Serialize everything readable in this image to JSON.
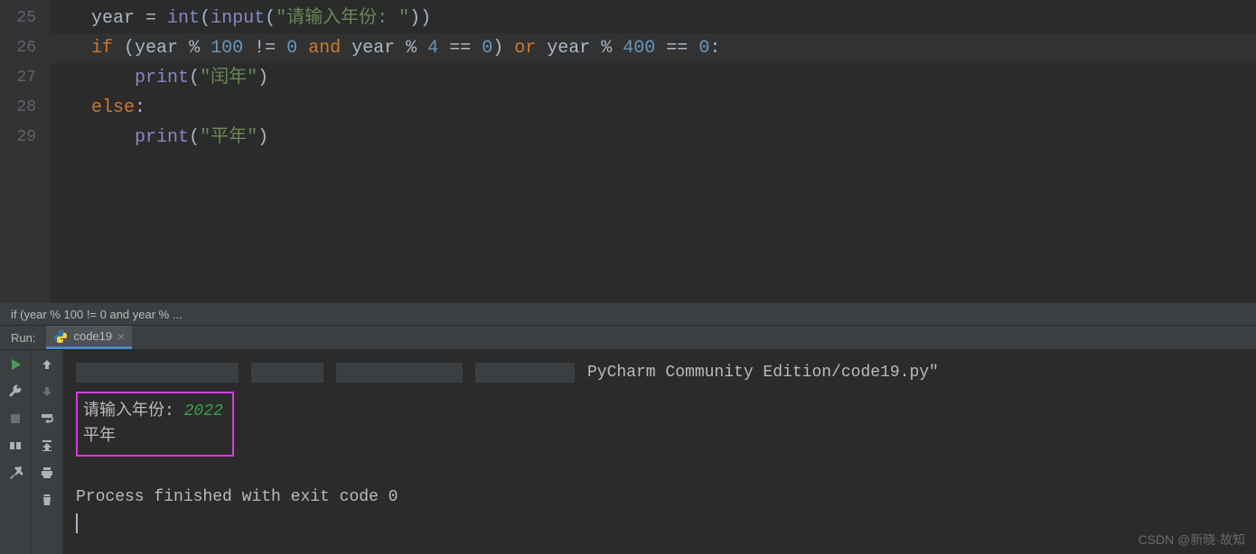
{
  "editor": {
    "lines": [
      25,
      26,
      27,
      28,
      29
    ],
    "highlighted_line": 26,
    "code": {
      "l25": {
        "var": "year",
        "eq": " = ",
        "int": "int",
        "p1": "(",
        "input": "input",
        "p2": "(",
        "str": "\"请输入年份: \"",
        "p3": "))"
      },
      "l26": {
        "if": "if",
        "sp1": " (",
        "var1": "year",
        "sp2": " % ",
        "n100": "100",
        "sp3": " != ",
        "z1": "0",
        "and": " and ",
        "var2": "year",
        "sp4": " % ",
        "n4": "4",
        "sp5": " == ",
        "z2": "0",
        "p2": ")",
        "or": " or ",
        "var3": "year",
        "sp6": " % ",
        "n400": "400",
        "sp7": " == ",
        "z3": "0",
        "colon": ":"
      },
      "l27": {
        "indent": "    ",
        "print": "print",
        "p1": "(",
        "str": "\"闰年\"",
        "p2": ")"
      },
      "l28": {
        "else": "else",
        "colon": ":"
      },
      "l29": {
        "indent": "    ",
        "print": "print",
        "p1": "(",
        "str": "\"平年\"",
        "p2": ")"
      }
    }
  },
  "breadcrumb": {
    "text": "if (year % 100 != 0 and year % ..."
  },
  "run": {
    "label": "Run:",
    "tab_name": "code19"
  },
  "console": {
    "path_visible": "PyCharm Community Edition/code19.py\"",
    "prompt": "请输入年份: ",
    "input_value": "2022",
    "result": "平年",
    "finished": "Process finished with exit code 0"
  },
  "watermark": "CSDN @新晓·故知"
}
